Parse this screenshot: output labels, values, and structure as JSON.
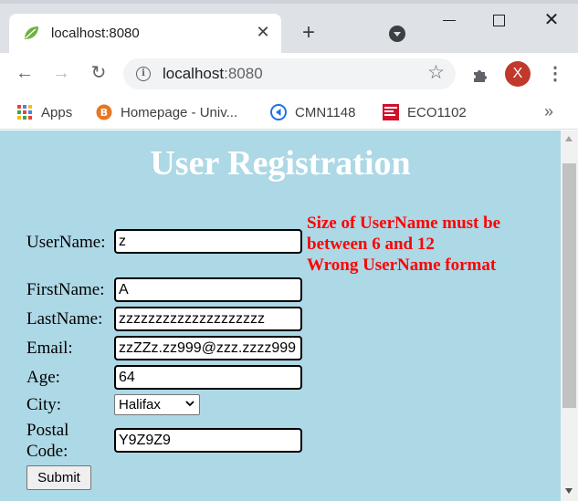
{
  "browser": {
    "tab_title": "localhost:8080",
    "new_tab_symbol": "+",
    "url_host": "localhost",
    "url_port": ":8080",
    "profile_initial": "X",
    "bookmarks": [
      {
        "label": "Apps",
        "icon": "apps-grid-icon"
      },
      {
        "label": "Homepage - Univ...",
        "icon": "brightspace-icon"
      },
      {
        "label": "CMN1148",
        "icon": "media-icon"
      },
      {
        "label": "ECO1102",
        "icon": "mcgraw-hill-icon"
      }
    ],
    "more_bookmarks": "»"
  },
  "page": {
    "title": "User Registration",
    "background_color": "#add8e6",
    "error_color": "#ff0000",
    "errors": [
      "Size of UserName must be",
      "between 6 and 12",
      "Wrong UserName format"
    ],
    "fields": {
      "username": {
        "label": "UserName:",
        "value": "z"
      },
      "firstname": {
        "label": "FirstName:",
        "value": "A"
      },
      "lastname": {
        "label": "LastName:",
        "value": "zzzzzzzzzzzzzzzzzzzz"
      },
      "email": {
        "label": "Email:",
        "value": "zzZZz.zz999@zzz.zzzz999"
      },
      "age": {
        "label": "Age:",
        "value": "64"
      },
      "city": {
        "label": "City:",
        "value": "Halifax"
      },
      "postal": {
        "label_line1": "Postal",
        "label_line2": "Code:",
        "value": "Y9Z9Z9"
      }
    },
    "submit_label": "Submit"
  }
}
